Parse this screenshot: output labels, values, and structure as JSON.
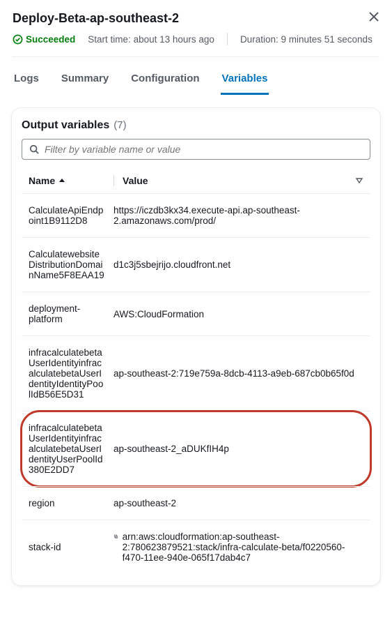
{
  "header": {
    "title": "Deploy-Beta-ap-southeast-2",
    "status_label": "Succeeded",
    "start_time_label": "Start time:",
    "start_time_value": "about 13 hours ago",
    "duration_label": "Duration:",
    "duration_value": "9 minutes 51 seconds"
  },
  "tabs": {
    "logs": "Logs",
    "summary": "Summary",
    "configuration": "Configuration",
    "variables": "Variables"
  },
  "card": {
    "title": "Output variables",
    "count": "(7)",
    "filter_placeholder": "Filter by variable name or value",
    "columns": {
      "name": "Name",
      "value": "Value"
    },
    "rows": [
      {
        "name": "CalculateApiEndpoint1B9112D8",
        "value": "https://iczdb3kx34.execute-api.ap-southeast-2.amazonaws.com/prod/"
      },
      {
        "name": "CalculatewebsiteDistributionDomainName5F8EAA19",
        "value": "d1c3j5sbejrijo.cloudfront.net"
      },
      {
        "name": "deployment-platform",
        "value": "AWS:CloudFormation"
      },
      {
        "name": "infracalculatebetaUserIdentityinfracalculatebetaUserIdentityIdentityPoolIdB56E5D31",
        "value": "ap-southeast-2:719e759a-8dcb-4113-a9eb-687cb0b65f0d"
      },
      {
        "name": "infracalculatebetaUserIdentityinfracalculatebetaUserIdentityUserPoolId380E2DD7",
        "value": "ap-southeast-2_aDUKfIH4p",
        "highlight": true
      },
      {
        "name": "region",
        "value": "ap-southeast-2"
      },
      {
        "name": "stack-id",
        "value": "arn:aws:cloudformation:ap-southeast-2:780623879521:stack/infra-calculate-beta/f0220560-f470-11ee-940e-065f17dab4c7",
        "copy": true
      }
    ]
  }
}
